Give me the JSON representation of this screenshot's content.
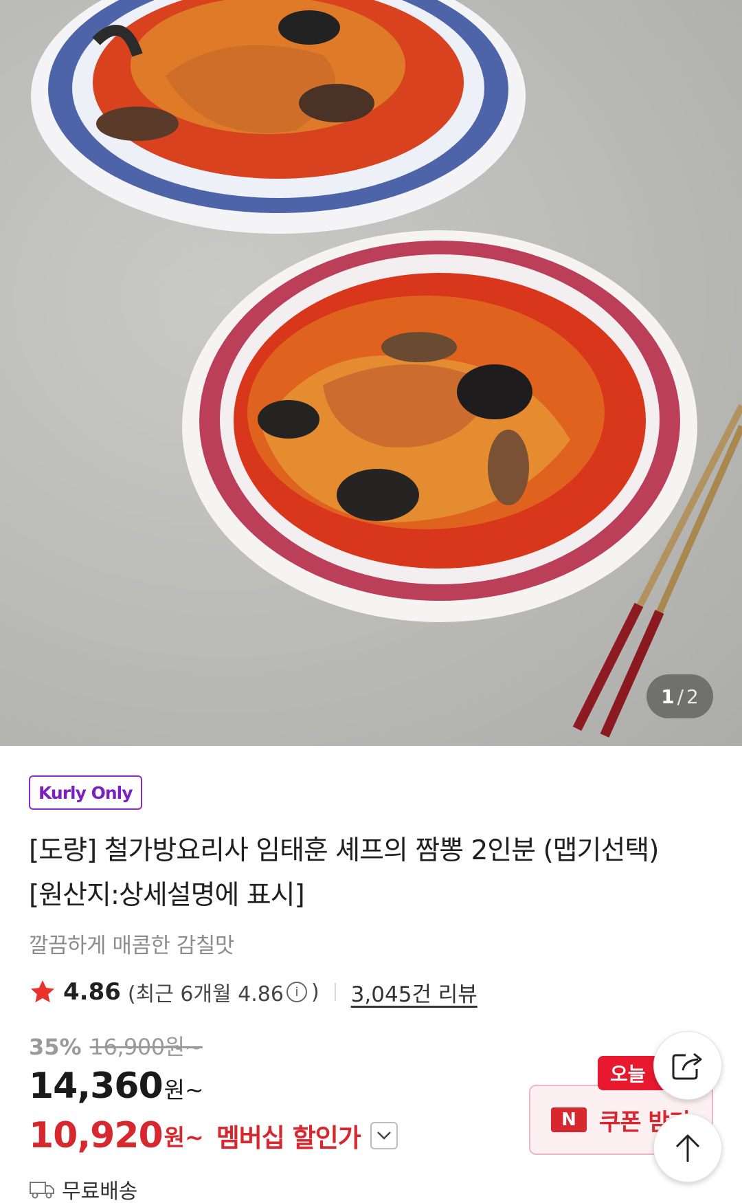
{
  "gallery": {
    "current": "1",
    "separator": "/",
    "total": "2"
  },
  "product": {
    "badge": "Kurly Only",
    "title_line1": "[도량] 철가방요리사 임태훈 셰프의 짬뽕 2인분 (맵기선택)",
    "title_line2": "[원산지:상세설명에 표시]",
    "subtitle": "깔끔하게 매콤한 감칠맛"
  },
  "rating": {
    "score": "4.86",
    "recent_open": "(최근 6개월 4.86",
    "recent_close": ")",
    "review_count": "3,045건 리뷰"
  },
  "price": {
    "discount_rate": "35%",
    "original": "16,900원~",
    "sale": "14,360",
    "sale_unit": "원~",
    "member_price": "10,920",
    "member_unit": "원~",
    "member_label": "멤버십 할인가"
  },
  "delivery": {
    "label": "무료배송"
  },
  "coupon": {
    "tag": "오늘",
    "logo": "N",
    "label": "쿠폰 받기"
  },
  "colors": {
    "accent_red": "#d6282e",
    "kurly_purple": "#7b1fbf",
    "star": "#e8332b"
  },
  "icons": [
    "star-icon",
    "info-icon",
    "chevron-down-icon",
    "truck-icon",
    "share-icon",
    "arrow-up-icon"
  ]
}
